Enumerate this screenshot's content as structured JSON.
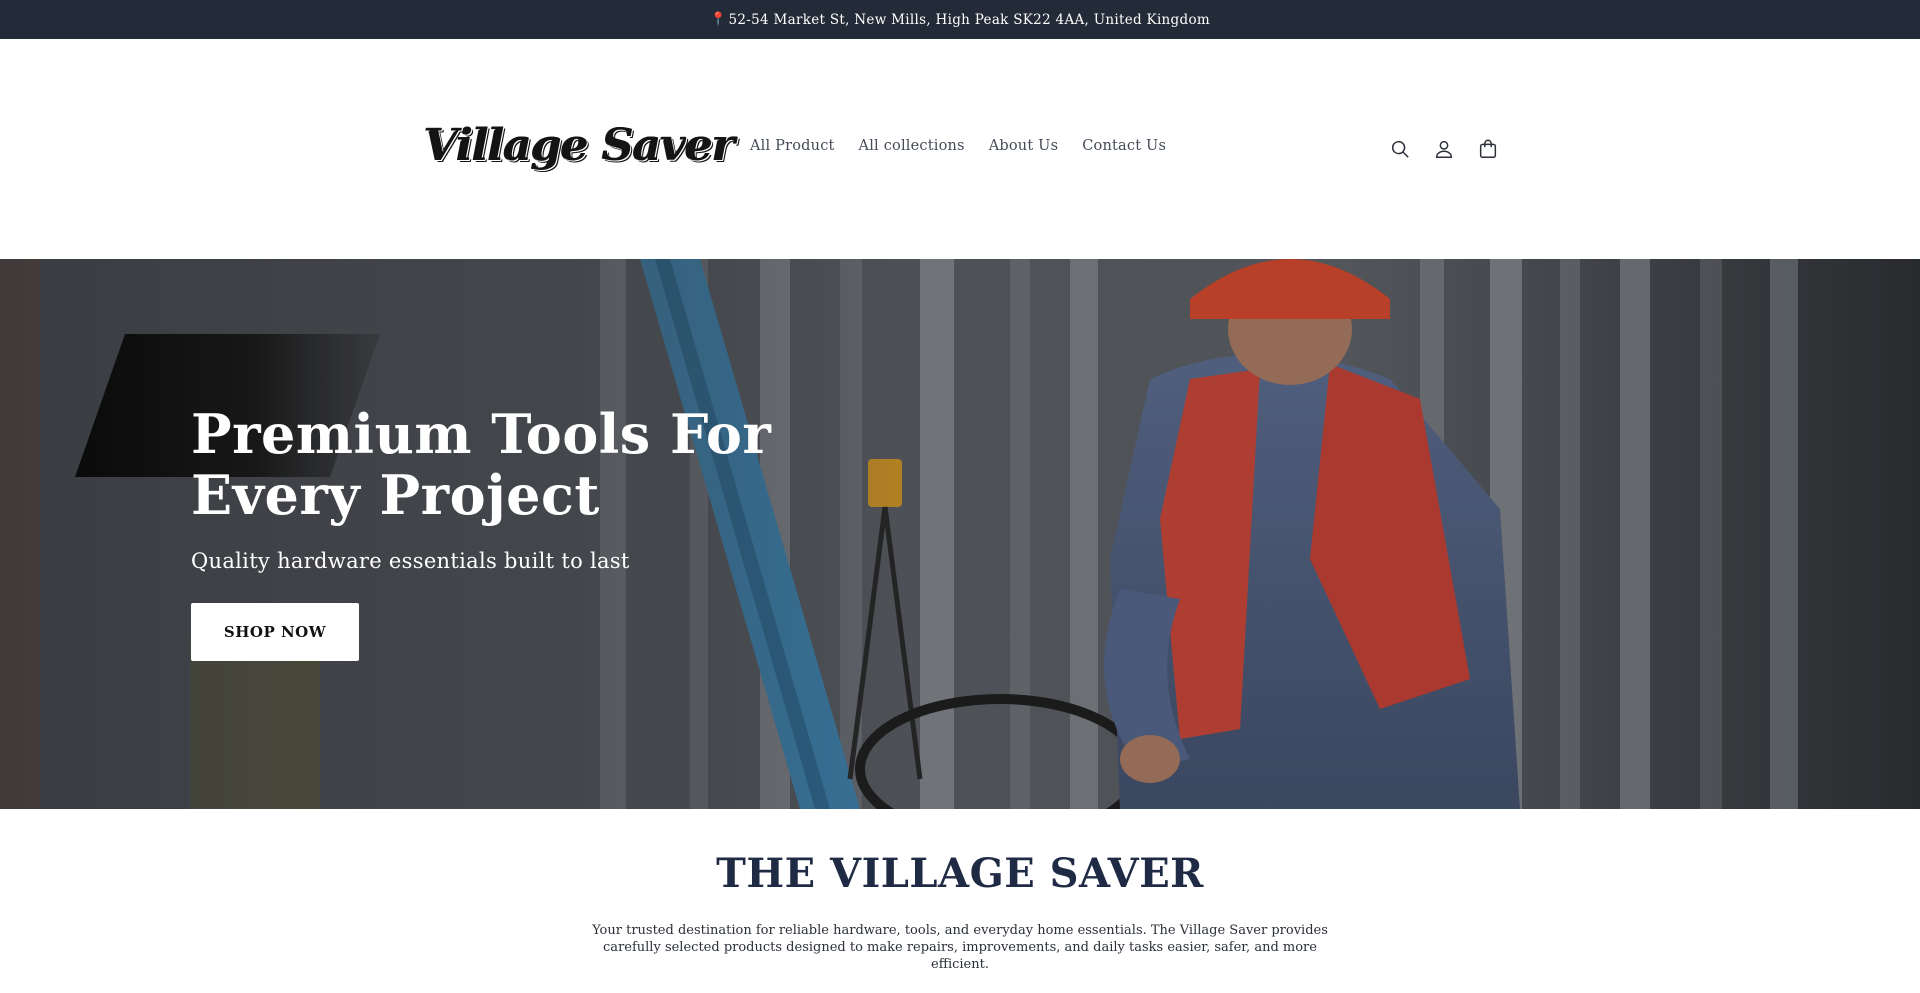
{
  "announcement": {
    "pin_icon": "pin-icon",
    "address": "52-54 Market St, New Mills, High Peak SK22 4AA, United Kingdom"
  },
  "header": {
    "logo_text": "Village Saver",
    "nav": [
      {
        "label": "All Product"
      },
      {
        "label": "All collections"
      },
      {
        "label": "About Us"
      },
      {
        "label": "Contact Us"
      }
    ],
    "icons": [
      "search-icon",
      "account-icon",
      "cart-icon"
    ]
  },
  "hero": {
    "title": "Premium Tools For Every Project",
    "subtitle": "Quality hardware essentials built to last",
    "button_label": "SHOP NOW"
  },
  "about": {
    "title": "THE VILLAGE SAVER",
    "text": "Your trusted destination for reliable hardware, tools, and everyday home essentials. The Village Saver provides carefully selected products designed to make repairs, improvements, and daily tasks easier, safer, and more efficient."
  },
  "colors": {
    "announcement_bg": "#232a38",
    "heading_navy": "#1f2a44",
    "vest_orange": "#c8473a",
    "hardhat_orange": "#d2482e"
  }
}
